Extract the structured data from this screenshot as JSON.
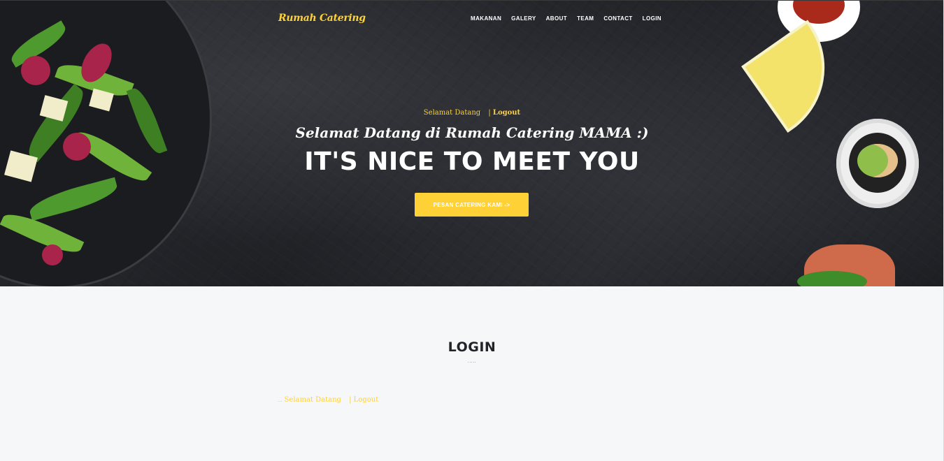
{
  "navbar": {
    "brand": "Rumah Catering",
    "links": [
      "MAKANAN",
      "GALERY",
      "ABOUT",
      "TEAM",
      "CONTACT",
      "LOGIN"
    ]
  },
  "hero": {
    "welcome": "Selamat Datang",
    "separator": "|",
    "logout": "Logout",
    "lead_in": "Selamat Datang di Rumah Catering MAMA :)",
    "heading": "IT'S NICE TO MEET YOU",
    "cta_label": "PESAN CATERING KAMI ->"
  },
  "login_section": {
    "title": "LOGIN",
    "dots": ".....",
    "mini_marker": "....",
    "welcome": "Selamat Datang",
    "separator": "|",
    "logout": "Logout"
  },
  "colors": {
    "accent": "#fed136",
    "hero_bg": "#1e2024",
    "page_bg": "#f6f7f9",
    "heading_dark": "#212529"
  }
}
